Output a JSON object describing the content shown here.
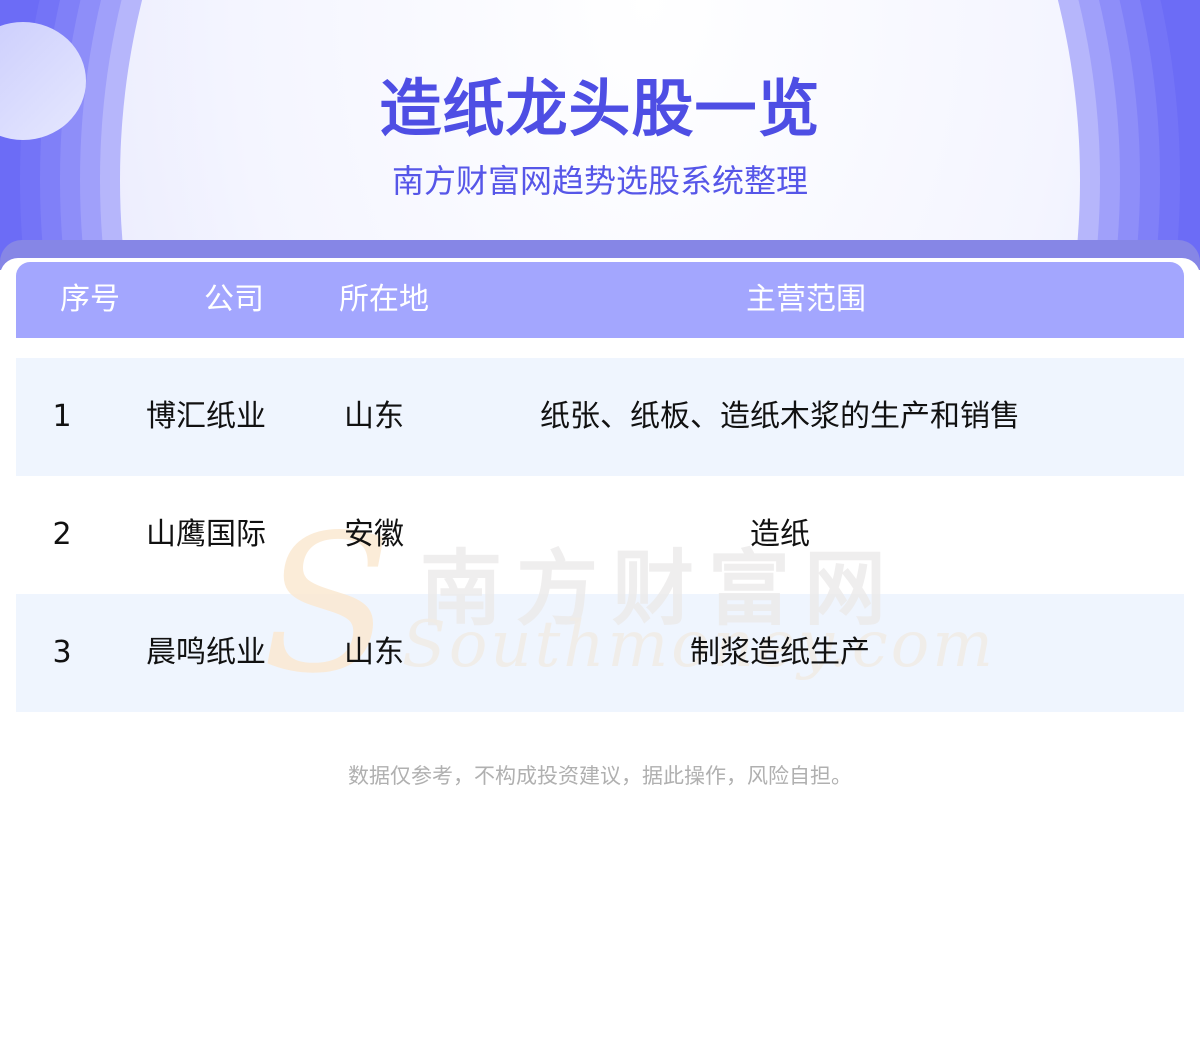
{
  "header": {
    "title": "造纸龙头股一览",
    "subtitle": "南方财富网趋势选股系统整理"
  },
  "table": {
    "columns": [
      "序号",
      "公司",
      "所在地",
      "主营范围"
    ],
    "rows": [
      {
        "index": "1",
        "company": "博汇纸业",
        "location": "山东",
        "scope": "纸张、纸板、造纸木浆的生产和销售"
      },
      {
        "index": "2",
        "company": "山鹰国际",
        "location": "安徽",
        "scope": "造纸"
      },
      {
        "index": "3",
        "company": "晨鸣纸业",
        "location": "山东",
        "scope": "制浆造纸生产"
      }
    ]
  },
  "watermark": {
    "cn": "南方财富网",
    "en": "Southmoney.com"
  },
  "footer": {
    "disclaimer": "数据仅参考，不构成投资建议，据此操作，风险自担。"
  },
  "colors": {
    "accent": "#4e4ee4",
    "header_row": "#a3a6fe",
    "alt_row": "#eff5fe"
  }
}
